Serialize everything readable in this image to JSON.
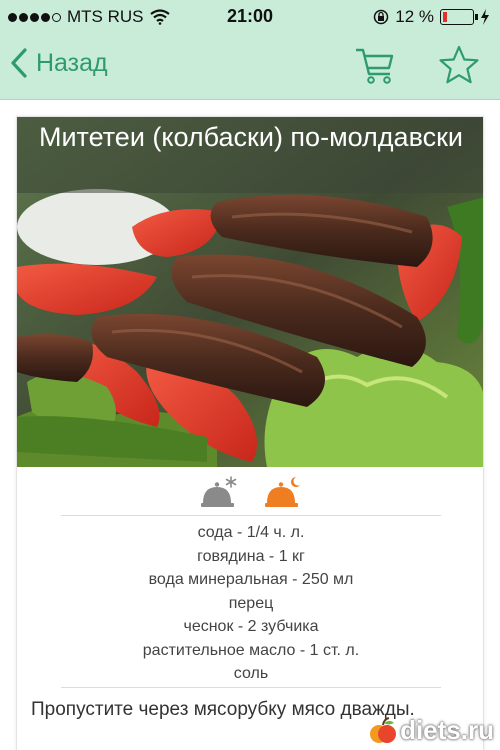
{
  "status_bar": {
    "carrier": "MTS RUS",
    "time": "21:00",
    "battery_percent": "12 %",
    "signal_bars_filled": 4,
    "signal_bars_total": 5
  },
  "nav": {
    "back_label": "Назад",
    "accent_color": "#2f9a70",
    "bar_color": "#c8ecd8"
  },
  "recipe": {
    "title": "Митетеи (колбаски) по-молдавски",
    "meal_icons": [
      "cloche-snowflake-icon",
      "cloche-moon-icon"
    ],
    "ingredients": [
      "сода - 1/4 ч. л.",
      "говядина - 1 кг",
      "вода минеральная - 250 мл",
      "перец",
      "чеснок - 2 зубчика",
      "растительное масло - 1 ст. л.",
      "соль"
    ],
    "instruction": "Пропустите через мясорубку мясо дважды."
  },
  "watermark": {
    "text": "diets.ru"
  }
}
